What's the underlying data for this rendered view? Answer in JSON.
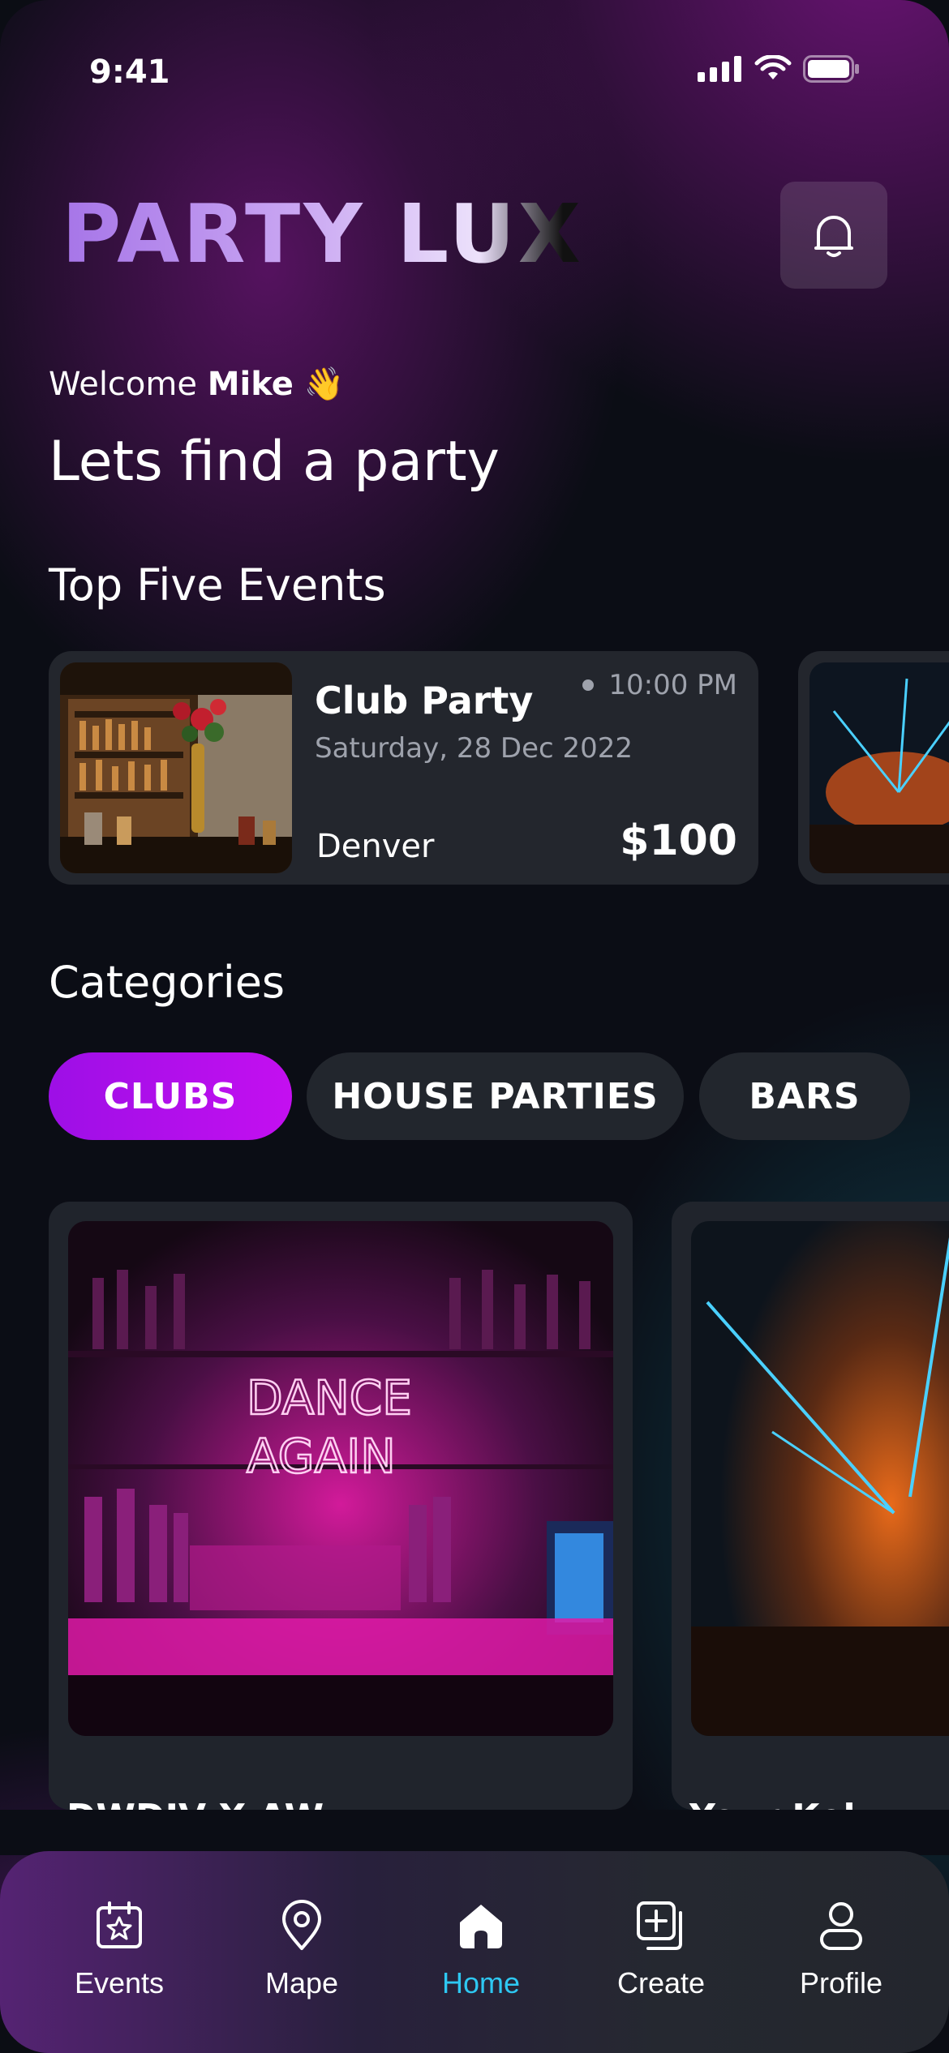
{
  "status_bar": {
    "time": "9:41"
  },
  "header": {
    "logo_text": "PARTY LUX"
  },
  "greeting": {
    "welcome_prefix": "Welcome ",
    "user_name": "Mike",
    "wave_emoji": "👋",
    "headline": "Lets find a party"
  },
  "top_events": {
    "title": "Top Five Events",
    "events": [
      {
        "name": "Club Party",
        "date": "Saturday, 28 Dec 2022",
        "time": "10:00 PM",
        "city": "Denver",
        "price": "$100"
      }
    ]
  },
  "categories": {
    "title": "Categories",
    "chips": [
      "CLUBS",
      "HOUSE PARTIES",
      "BARS"
    ],
    "active_chip": "CLUBS",
    "cards": [
      {
        "neon_line1": "DANCE",
        "neon_line2": "AGAIN",
        "title": "DWDJV X AW"
      },
      {
        "title": "Your Kel"
      }
    ]
  },
  "bottom_nav": {
    "items": [
      {
        "label": "Events",
        "icon": "calendar-star-icon"
      },
      {
        "label": "Mape",
        "icon": "map-pin-icon"
      },
      {
        "label": "Home",
        "icon": "home-icon"
      },
      {
        "label": "Create",
        "icon": "add-square-icon"
      },
      {
        "label": "Profile",
        "icon": "profile-icon"
      }
    ],
    "active": "Home",
    "active_color": "#2ec8f2"
  },
  "colors": {
    "accent_purple": "#b10fee",
    "card_bg": "#23262d",
    "muted_text": "#9ea2ac"
  }
}
